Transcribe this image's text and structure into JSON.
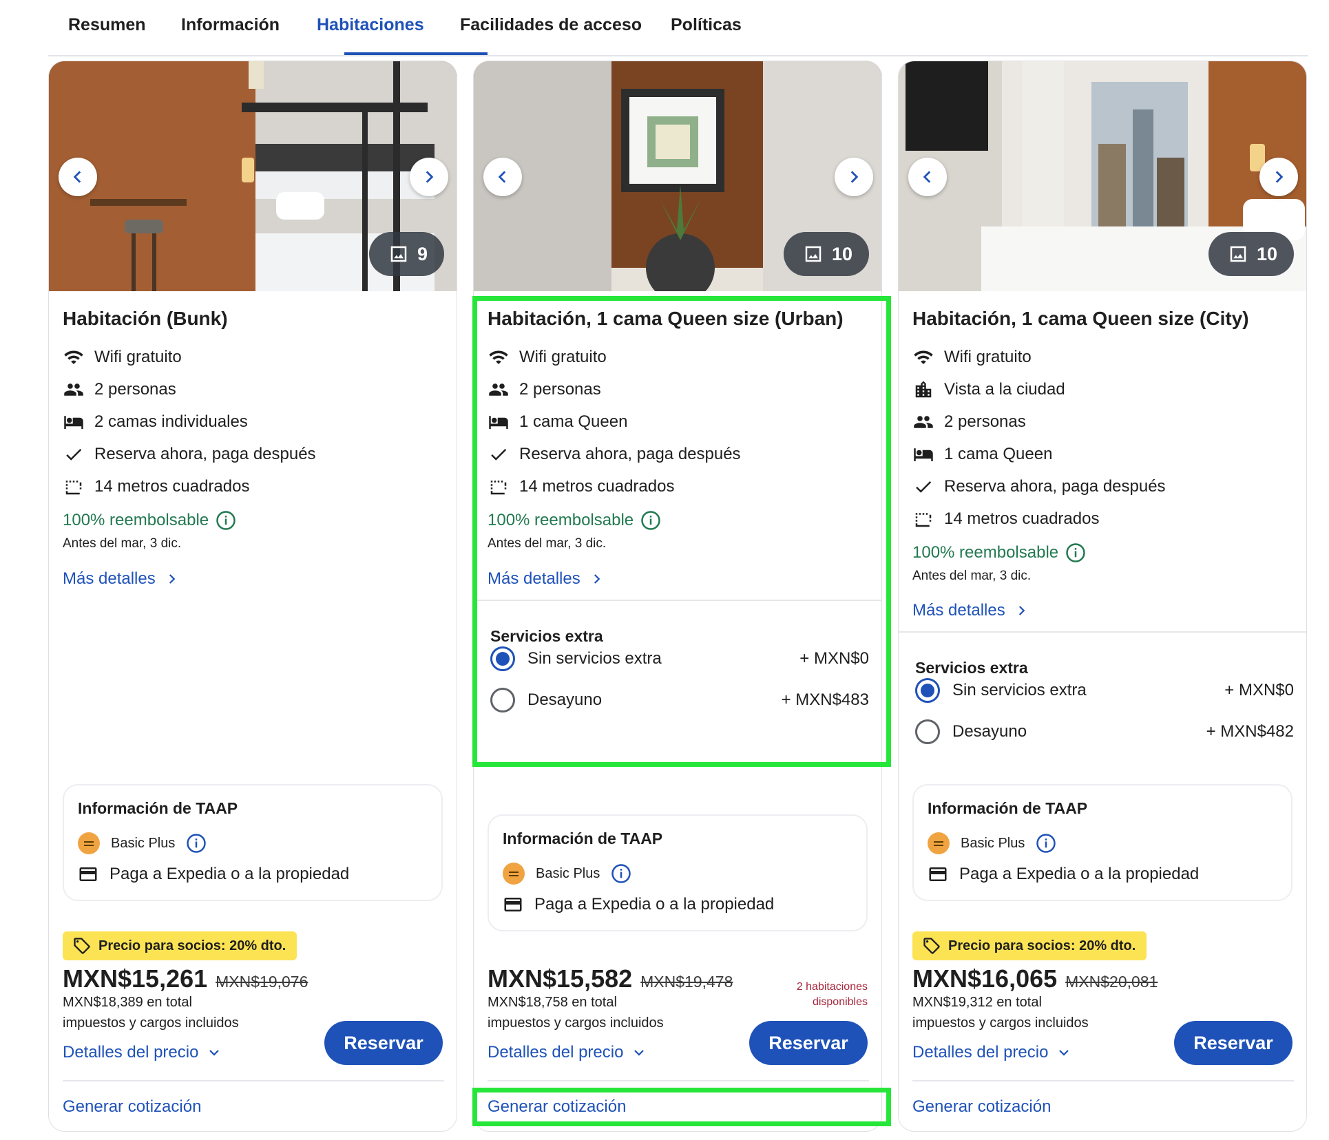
{
  "tabs": [
    {
      "label": "Resumen"
    },
    {
      "label": "Información"
    },
    {
      "label": "Habitaciones",
      "active": true
    },
    {
      "label": "Facilidades de acceso"
    },
    {
      "label": "Políticas"
    }
  ],
  "colors": {
    "link": "#1f52b8",
    "refundable": "#227950",
    "promo": "#fce354",
    "highlight": "#27e63a",
    "availability": "#a8253a"
  },
  "rooms": [
    {
      "photo_count": "9",
      "title": "Habitación (Bunk)",
      "features": [
        {
          "icon": "wifi-icon",
          "text": "Wifi gratuito"
        },
        {
          "icon": "people-icon",
          "text": "2 personas"
        },
        {
          "icon": "bed-icon",
          "text": "2 camas individuales"
        },
        {
          "icon": "check-icon",
          "text": "Reserva ahora, paga después"
        },
        {
          "icon": "area-icon",
          "text": "14 metros cuadrados"
        }
      ],
      "refundable": "100% reembolsable",
      "refund_before": "Antes del mar, 3 dic.",
      "more_details": "Más detalles",
      "taap": {
        "title": "Información de TAAP",
        "tier": "Basic Plus",
        "payment": "Paga a Expedia o a la propiedad"
      },
      "promo": "Precio para socios: 20% dto.",
      "price": "MXN$15,261",
      "old_price": "MXN$19,076",
      "total": "MXN$18,389 en total",
      "taxes": "impuestos y cargos incluidos",
      "price_details": "Detalles del precio",
      "reserve": "Reservar",
      "quote": "Generar cotización"
    },
    {
      "photo_count": "10",
      "title": "Habitación, 1 cama Queen size (Urban)",
      "features": [
        {
          "icon": "wifi-icon",
          "text": "Wifi gratuito"
        },
        {
          "icon": "people-icon",
          "text": "2 personas"
        },
        {
          "icon": "bed-icon",
          "text": "1 cama Queen"
        },
        {
          "icon": "check-icon",
          "text": "Reserva ahora, paga después"
        },
        {
          "icon": "area-icon",
          "text": "14 metros cuadrados"
        }
      ],
      "refundable": "100% reembolsable",
      "refund_before": "Antes del mar, 3 dic.",
      "more_details": "Más detalles",
      "extras_title": "Servicios extra",
      "extras": [
        {
          "label": "Sin servicios extra",
          "price": "+ MXN$0",
          "selected": true
        },
        {
          "label": "Desayuno",
          "price": "+ MXN$483",
          "selected": false
        }
      ],
      "taap": {
        "title": "Información de TAAP",
        "tier": "Basic Plus",
        "payment": "Paga a Expedia o a la propiedad"
      },
      "price": "MXN$15,582",
      "old_price": "MXN$19,478",
      "availability_line1": "2 habitaciones",
      "availability_line2": "disponibles",
      "total": "MXN$18,758 en total",
      "taxes": "impuestos y cargos incluidos",
      "price_details": "Detalles del precio",
      "reserve": "Reservar",
      "quote": "Generar cotización"
    },
    {
      "photo_count": "10",
      "title": "Habitación, 1 cama Queen size (City)",
      "features": [
        {
          "icon": "wifi-icon",
          "text": "Wifi gratuito"
        },
        {
          "icon": "city-icon",
          "text": "Vista a la ciudad"
        },
        {
          "icon": "people-icon",
          "text": "2 personas"
        },
        {
          "icon": "bed-icon",
          "text": "1 cama Queen"
        },
        {
          "icon": "check-icon",
          "text": "Reserva ahora, paga después"
        },
        {
          "icon": "area-icon",
          "text": "14 metros cuadrados"
        }
      ],
      "refundable": "100% reembolsable",
      "refund_before": "Antes del mar, 3 dic.",
      "more_details": "Más detalles",
      "extras_title": "Servicios extra",
      "extras": [
        {
          "label": "Sin servicios extra",
          "price": "+ MXN$0",
          "selected": true
        },
        {
          "label": "Desayuno",
          "price": "+ MXN$482",
          "selected": false
        }
      ],
      "taap": {
        "title": "Información de TAAP",
        "tier": "Basic Plus",
        "payment": "Paga a Expedia o a la propiedad"
      },
      "promo": "Precio para socios: 20% dto.",
      "price": "MXN$16,065",
      "old_price": "MXN$20,081",
      "total": "MXN$19,312 en total",
      "taxes": "impuestos y cargos incluidos",
      "price_details": "Detalles del precio",
      "reserve": "Reservar",
      "quote": "Generar cotización"
    }
  ]
}
